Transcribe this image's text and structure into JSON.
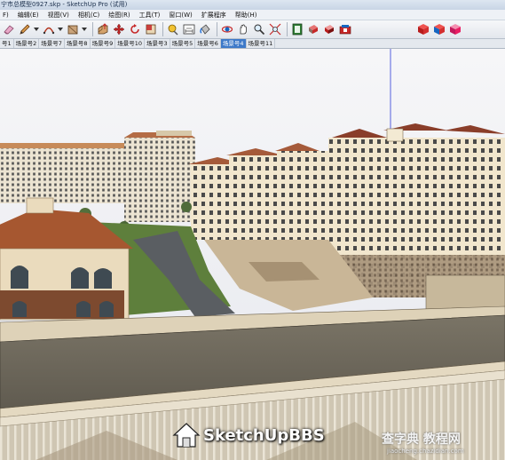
{
  "window": {
    "title": "宁市总模型0927.skp - SketchUp Pro (试用)"
  },
  "menu": [
    "F)",
    "编辑(E)",
    "视图(V)",
    "相机(C)",
    "绘图(R)",
    "工具(T)",
    "窗口(W)",
    "扩展程序",
    "帮助(H)"
  ],
  "toolbar": {
    "tools": [
      "eraser-icon",
      "pencil-icon",
      "arc-icon",
      "shape-icon",
      "pushpull-icon",
      "move-icon",
      "rotate-icon",
      "scale-icon",
      "tape-measure-icon",
      "dimension-icon",
      "paint-bucket-icon",
      "orbit-icon",
      "pan-icon",
      "zoom-icon",
      "zoom-extents-icon",
      "components-icon",
      "materials-icon",
      "styles-icon",
      "warehouse-icon",
      "section-red-icon",
      "section-blue-icon",
      "section-pink-icon"
    ]
  },
  "scenes": {
    "tabs": [
      "号1",
      "场景号2",
      "场景号7",
      "场景号8",
      "场景号9",
      "场景号10",
      "场景号3",
      "场景号5",
      "场景号6",
      "场景号4",
      "场景号11"
    ],
    "active": "场景号4"
  },
  "watermarks": {
    "left_text": "SketchUpBBS",
    "right_main": "查字典 教程网",
    "right_sub": "jiaocheng.chazidian.com"
  }
}
